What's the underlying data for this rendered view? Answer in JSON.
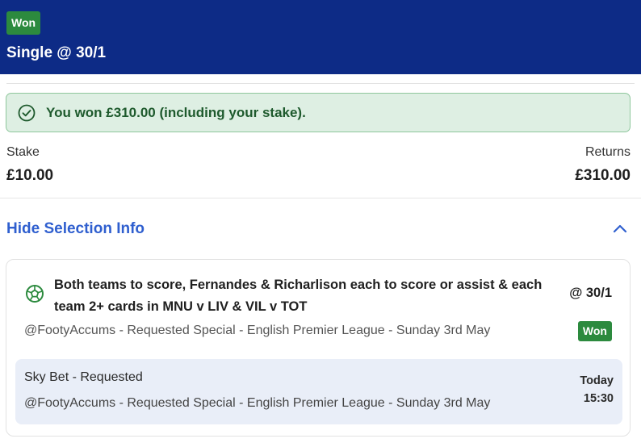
{
  "header": {
    "status_badge": "Won",
    "bet_title": "Single @ 30/1"
  },
  "win_banner": {
    "message": "You won £310.00 (including your stake).",
    "icon": "check-circle-icon"
  },
  "summary": {
    "stake_label": "Stake",
    "stake_value": "£10.00",
    "returns_label": "Returns",
    "returns_value": "£310.00"
  },
  "selection_toggle": {
    "label": "Hide Selection Info",
    "icon": "chevron-up-icon"
  },
  "selection": {
    "icon": "football-icon",
    "name": "Both teams to score, Fernandes & Richarlison each to score or assist & each team 2+ cards in MNU v LIV & VIL v TOT",
    "odds": "@ 30/1",
    "market": "@FootyAccums - Requested Special - English Premier League - Sunday 3rd May",
    "status": "Won",
    "event": {
      "title": "Sky Bet - Requested",
      "market": "@FootyAccums - Requested Special - English Premier League - Sunday 3rd May",
      "day": "Today",
      "time": "15:30"
    }
  },
  "colors": {
    "header_bg": "#0d2b86",
    "won_green": "#2c8a3e",
    "banner_bg": "#deefe3",
    "link_blue": "#2f5fcf",
    "event_bg": "#e9eef8"
  }
}
